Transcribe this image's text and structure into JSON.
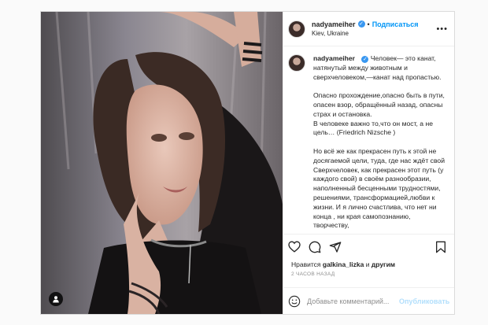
{
  "post": {
    "username": "nadyameiher",
    "verified_mark": "✓",
    "dot": "•",
    "follow_label": "Подписаться",
    "location": "Kiev, Ukraine",
    "more_label": "•••",
    "caption_username": "nadyameiher",
    "caption_paragraphs": [
      "Человек— это канат, натянутый между животным и сверхчеловеком,—канат над пропастью.",
      "Опасно прохождение,опасно быть в пути, опасен взор, обращённый назад, опасны страх и остановка.",
      "В человеке важно то,что он мост, а не цель… (Friedrich Nizsche )",
      "Но всё же как прекрасен путь к этой не досягаемой цели, туда, где нас ждёт свой Сверхчеловек, как прекрасен этот путь (у каждого свой) в своём разнообразии, наполненный бесценными трудностями, решениями, трансформацией,любви к жизни. И я лично счастлива, что нет ни конца , ни края самопознанию, творчеству,"
    ],
    "likes_prefix": "Нравится",
    "likes_user": "galkina_lizka",
    "likes_and": "и",
    "likes_others": "другим",
    "time": "2 ЧАСОВ НАЗАД",
    "comment_placeholder": "Добавьте комментарий...",
    "publish_label": "Опубликовать"
  },
  "icons": {
    "like": "heart-icon",
    "comment": "comment-icon",
    "share": "share-icon",
    "save": "bookmark-icon",
    "emoji": "emoji-icon",
    "tag": "user-tag-icon"
  },
  "colors": {
    "accent": "#0095f6",
    "verified": "#3897f0",
    "publish_disabled": "#b2dffc",
    "muted": "#8e8e8e"
  }
}
